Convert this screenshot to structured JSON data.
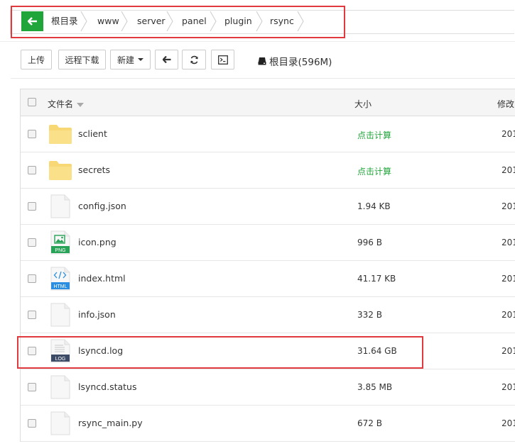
{
  "breadcrumb": {
    "items": [
      "根目录",
      "www",
      "server",
      "panel",
      "plugin",
      "rsync"
    ]
  },
  "toolbar": {
    "upload_label": "上传",
    "remote_download_label": "远程下载",
    "new_label": "新建",
    "disk_label": "根目录(596M)"
  },
  "table": {
    "headers": {
      "name": "文件名",
      "size": "大小",
      "modified": "修改"
    },
    "rows": [
      {
        "name": "sclient",
        "size": "点击计算",
        "date": "201",
        "type": "folder"
      },
      {
        "name": "secrets",
        "size": "点击计算",
        "date": "201",
        "type": "folder"
      },
      {
        "name": "config.json",
        "size": "1.94 KB",
        "date": "201",
        "type": "file"
      },
      {
        "name": "icon.png",
        "size": "996 B",
        "date": "201",
        "type": "png"
      },
      {
        "name": "index.html",
        "size": "41.17 KB",
        "date": "201",
        "type": "html"
      },
      {
        "name": "info.json",
        "size": "332 B",
        "date": "201",
        "type": "file"
      },
      {
        "name": "lsyncd.log",
        "size": "31.64 GB",
        "date": "201",
        "type": "log"
      },
      {
        "name": "lsyncd.status",
        "size": "3.85 MB",
        "date": "201",
        "type": "file"
      },
      {
        "name": "rsync_main.py",
        "size": "672 B",
        "date": "201",
        "type": "file"
      }
    ]
  },
  "file_badges": {
    "png": "PNG",
    "html": "HTML",
    "log": "LOG"
  },
  "colors": {
    "accent_green": "#20a53a",
    "highlight_red": "#e0393e"
  }
}
